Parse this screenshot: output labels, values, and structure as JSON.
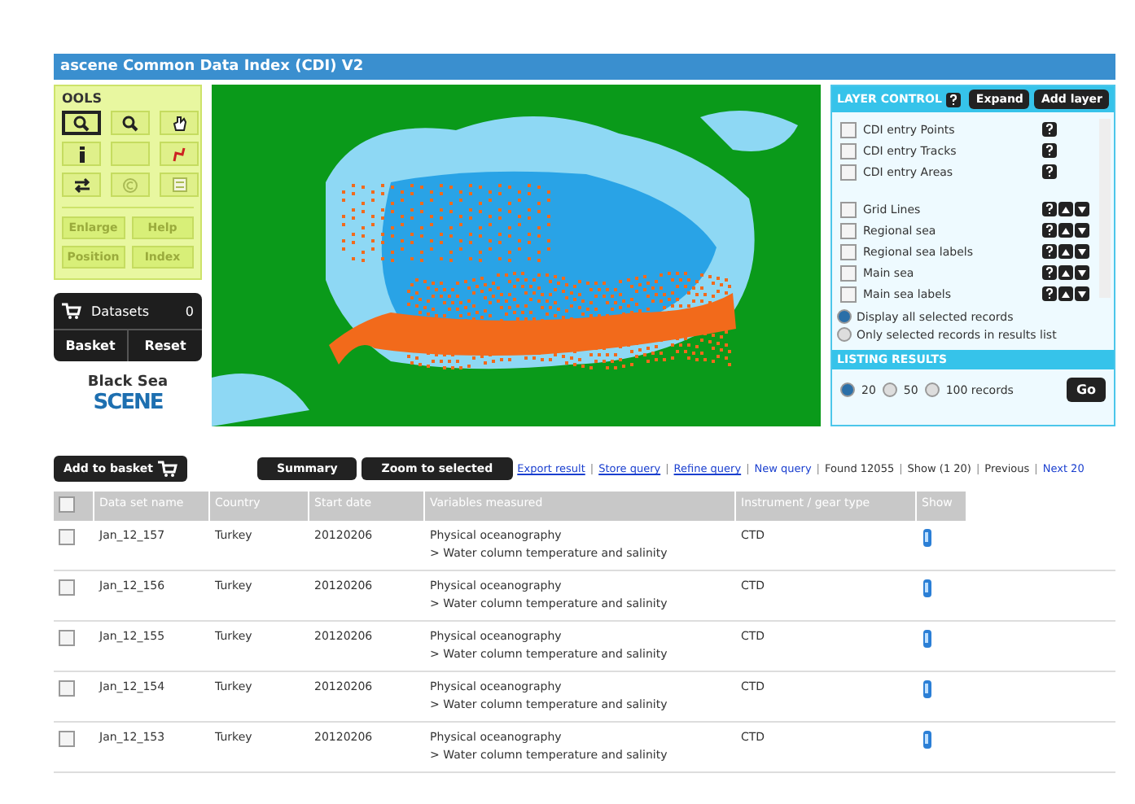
{
  "header": {
    "title": "ascene Common Data Index (CDI) V2"
  },
  "tools": {
    "title": "OOLS",
    "buttons": [
      {
        "selected": true
      },
      {
        "selected": false
      },
      {
        "selected": false
      },
      {
        "selected": false
      },
      {
        "selected": false
      },
      {
        "selected": false
      },
      {
        "selected": false
      },
      {
        "selected": false
      },
      {
        "selected": false
      }
    ],
    "actions": [
      "Enlarge",
      "Help",
      "Position",
      "Index"
    ]
  },
  "basket": {
    "label": "Datasets",
    "count": "0",
    "buttons": [
      "Basket",
      "Reset"
    ]
  },
  "logo": {
    "line1": "Black Sea",
    "line2": "SCENE"
  },
  "layer_control": {
    "title": "LAYER CONTROL",
    "buttons": [
      "Expand",
      "Add layer"
    ],
    "layers": [
      {
        "label": "CDI entry Points",
        "checked": false,
        "kind": "entry"
      },
      {
        "label": "CDI entry Tracks",
        "checked": false,
        "kind": "entry"
      },
      {
        "label": "CDI entry Areas",
        "checked": false,
        "kind": "entry"
      },
      {
        "label": "Grid Lines",
        "checked": false,
        "kind": "base"
      },
      {
        "label": "Regional sea",
        "checked": false,
        "kind": "base"
      },
      {
        "label": "Regional sea labels",
        "checked": false,
        "kind": "base"
      },
      {
        "label": "Main sea",
        "checked": false,
        "kind": "base"
      },
      {
        "label": "Main sea labels",
        "checked": false,
        "kind": "base"
      }
    ],
    "display": [
      {
        "label": "Display all selected records",
        "selected": true
      },
      {
        "label": "Only selected records in results list",
        "selected": false
      }
    ]
  },
  "listing": {
    "title": "LISTING RESULTS",
    "options": [
      {
        "label": "20",
        "selected": true
      },
      {
        "label": "50",
        "selected": false
      },
      {
        "label": "100 records",
        "selected": false
      }
    ],
    "go": "Go"
  },
  "toolbar": {
    "separator": "|",
    "add": "Add to basket",
    "buttons": [
      "Summary",
      "Zoom to selected"
    ],
    "links": [
      "Export result",
      "Store query",
      "Refine query",
      "New query"
    ],
    "found": "Found 12055",
    "show": "Show (1 20)",
    "previous": "Previous",
    "next": "Next 20"
  },
  "table": {
    "select_all_checked": false,
    "columns": [
      "Data set name",
      "Country",
      "Start date",
      "Variables measured",
      "Instrument / gear type",
      "Show"
    ],
    "rows": [
      {
        "name": "Jan_12_157",
        "country": "Turkey",
        "date": "20120206",
        "variable": "Physical oceanography",
        "detail": "> Water column temperature and salinity",
        "instrument": "CTD",
        "checked": false
      },
      {
        "name": "Jan_12_156",
        "country": "Turkey",
        "date": "20120206",
        "variable": "Physical oceanography",
        "detail": "> Water column temperature and salinity",
        "instrument": "CTD",
        "checked": false
      },
      {
        "name": "Jan_12_155",
        "country": "Turkey",
        "date": "20120206",
        "variable": "Physical oceanography",
        "detail": "> Water column temperature and salinity",
        "instrument": "CTD",
        "checked": false
      },
      {
        "name": "Jan_12_154",
        "country": "Turkey",
        "date": "20120206",
        "variable": "Physical oceanography",
        "detail": "> Water column temperature and salinity",
        "instrument": "CTD",
        "checked": false
      },
      {
        "name": "Jan_12_153",
        "country": "Turkey",
        "date": "20120206",
        "variable": "Physical oceanography",
        "detail": "> Water column temperature and salinity",
        "instrument": "CTD",
        "checked": false
      }
    ]
  }
}
